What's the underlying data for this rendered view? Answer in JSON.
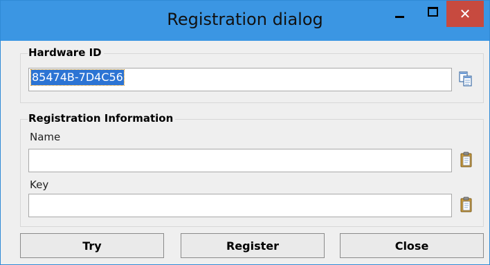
{
  "window": {
    "title": "Registration dialog",
    "controls": {
      "minimize_icon": "minimize-icon",
      "maximize_icon": "maximize-icon",
      "close_glyph": "✕",
      "close_color": "#c74a3f"
    },
    "titlebar_color": "#3b96e3"
  },
  "hardware": {
    "group_title": "Hardware ID",
    "value": "85474B-7D4C56",
    "copy_icon": "copy-icon"
  },
  "registration": {
    "group_title": "Registration Information",
    "name_label": "Name",
    "name_value": "",
    "key_label": "Key",
    "key_value": "",
    "paste_icon": "paste-icon"
  },
  "buttons": {
    "try": "Try",
    "register": "Register",
    "close": "Close"
  }
}
